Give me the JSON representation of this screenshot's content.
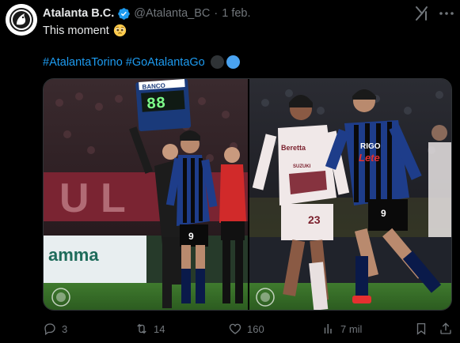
{
  "author": {
    "name": "Atalanta B.C.",
    "handle": "@Atalanta_BC",
    "separator": "·",
    "time": "1 feb."
  },
  "tweet": {
    "text": "This moment",
    "emoji": "pleading-face-emoji",
    "hashtags": [
      "#AtalantaTorino",
      "#GoAtalantaGo"
    ],
    "color_circles": [
      "#2f3336",
      "#4aa3f0"
    ]
  },
  "media": {
    "left_image": {
      "board_text": "BANCO",
      "board_number": "88",
      "player_number": "9",
      "sponsor_text": "amma"
    },
    "right_image": {
      "player1_sponsor": "Beretta",
      "player1_brand": "SUZUKI",
      "player1_number": "23",
      "player2_sponsor": "Lete",
      "player2_brand": "RIGO",
      "player2_number": "9"
    }
  },
  "actions": {
    "replies": "3",
    "reposts": "14",
    "likes": "160",
    "views": "7 mil"
  },
  "colors": {
    "accent": "#1d9bf0",
    "muted": "#71767b",
    "background": "#000000"
  }
}
